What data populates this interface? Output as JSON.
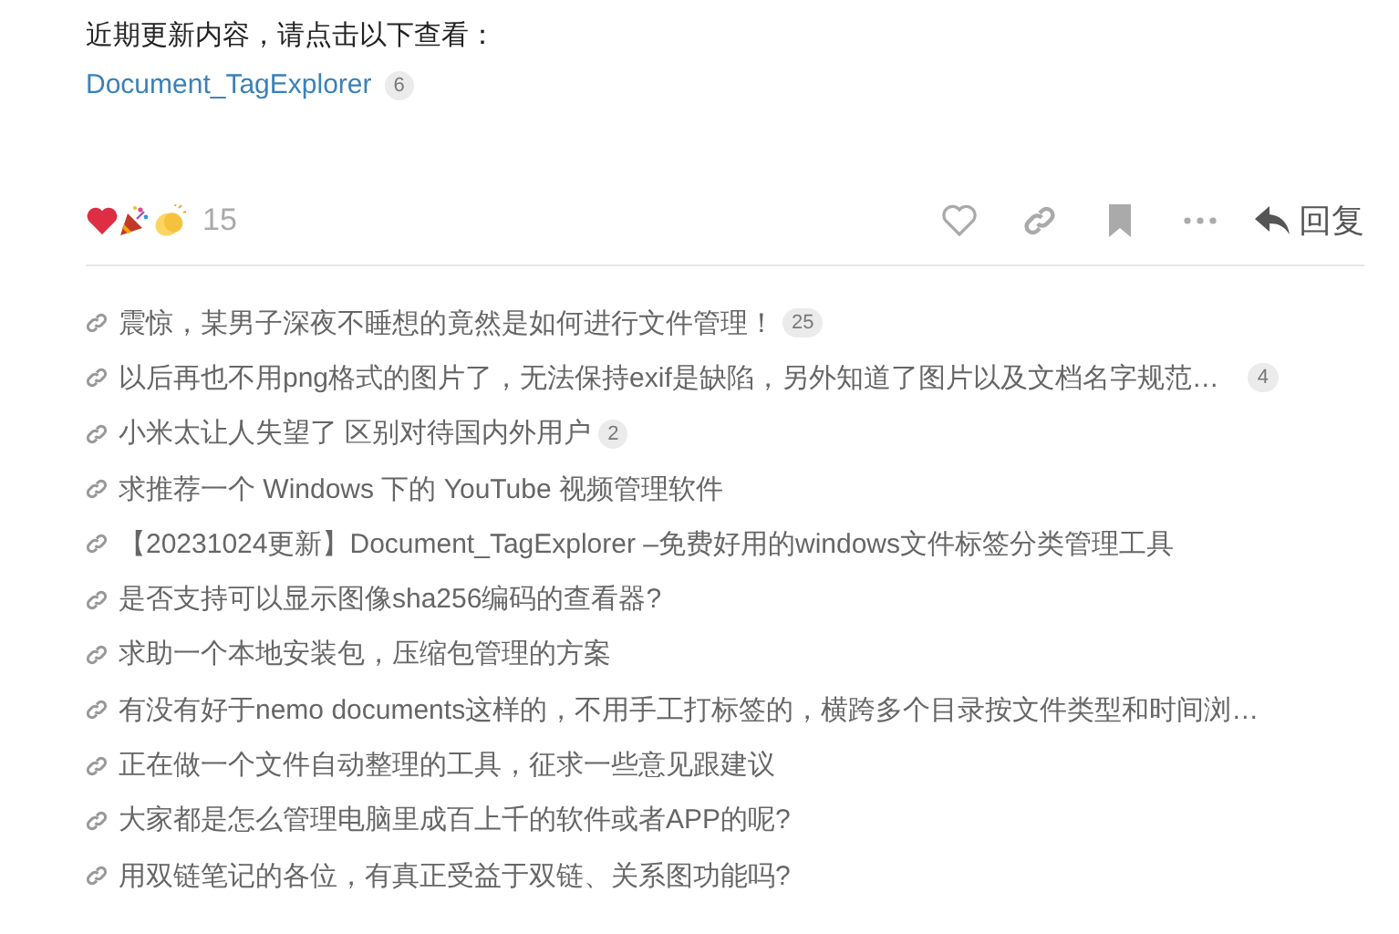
{
  "intro": "近期更新内容，请点击以下查看：",
  "featured_link": {
    "title": "Document_TagExplorer",
    "count": "6"
  },
  "reactions": {
    "count": "15"
  },
  "actions": {
    "reply": "回复",
    "liked": false,
    "bookmarked": false
  },
  "related_topics": [
    {
      "title": "震惊，某男子深夜不睡想的竟然是如何进行文件管理！",
      "count": "25"
    },
    {
      "title": "以后再也不用png格式的图片了，无法保持exif是缺陷，另外知道了图片以及文档名字规范…",
      "count": "4"
    },
    {
      "title": "小米太让人失望了 区别对待国内外用户",
      "count": "2"
    },
    {
      "title": "求推荐一个 Windows 下的 YouTube 视频管理软件"
    },
    {
      "title": "【20231024更新】Document_TagExplorer –免费好用的windows文件标签分类管理工具"
    },
    {
      "title": "是否支持可以显示图像sha256编码的查看器?"
    },
    {
      "title": "求助一个本地安装包，压缩包管理的方案"
    },
    {
      "title": "有没有好于nemo documents这样的，不用手工打标签的，横跨多个目录按文件类型和时间浏…"
    },
    {
      "title": "正在做一个文件自动整理的工具，征求一些意见跟建议"
    },
    {
      "title": "大家都是怎么管理电脑里成百上千的软件或者APP的呢?"
    },
    {
      "title": "用双链笔记的各位，有真正受益于双链、关系图功能吗?"
    }
  ]
}
